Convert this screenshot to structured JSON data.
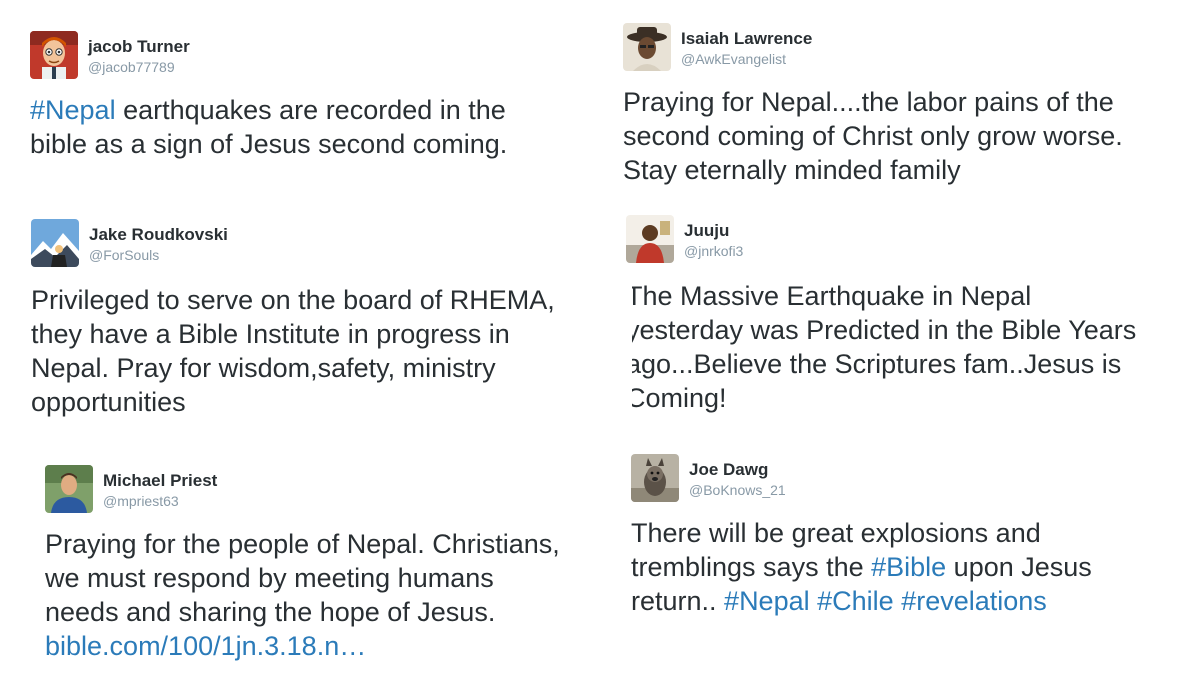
{
  "tweets": [
    {
      "name": "jacob Turner",
      "handle": "@jacob77789",
      "avatar": "cartoon-avatar",
      "text": {
        "hashtag": "#Nepal",
        "rest": "  earthquakes are recorded in the\nbible as a sign of Jesus second coming."
      }
    },
    {
      "name": "Isaiah Lawrence",
      "handle": "@AwkEvangelist",
      "avatar": "hat-person-avatar",
      "text": "Praying for Nepal....the labor pains of the\nsecond coming of Christ only grow worse.\nStay eternally minded family"
    },
    {
      "name": "Jake Roudkovski",
      "handle": "@ForSouls",
      "avatar": "mountain-avatar",
      "text": "Privileged to serve on the board of RHEMA,\nthey have a Bible Institute in progress in\nNepal. Pray for wisdom,safety, ministry\nopportunities"
    },
    {
      "name": "Juuju",
      "handle": "@jnrkofi3",
      "avatar": "person-red-avatar",
      "text": "The Massive Earthquake in Nepal\nyesterday was Predicted in the Bible Years\nago...Believe the Scriptures fam..Jesus is\nComing!"
    },
    {
      "name": "Michael Priest",
      "handle": "@mpriest63",
      "avatar": "man-blue-shirt-avatar",
      "text": {
        "body": "Praying for the people of Nepal. Christians,\nwe must respond by meeting humans\nneeds and sharing the hope of Jesus.",
        "link": "bible.com/100/1jn.3.18.n…"
      }
    },
    {
      "name": "Joe Dawg",
      "handle": "@BoKnows_21",
      "avatar": "dog-avatar",
      "text": {
        "line1": "There will be great explosions and",
        "line2_pre": "tremblings says the ",
        "line2_tag": "#Bible",
        "line2_post": " upon Jesus",
        "line3_pre": "return.. ",
        "tags": [
          "#Nepal",
          "#Chile",
          "#revelations"
        ]
      }
    }
  ],
  "colors": {
    "name": "#292f33",
    "handle": "#8899a6",
    "hashtag": "#2b7bb9"
  }
}
